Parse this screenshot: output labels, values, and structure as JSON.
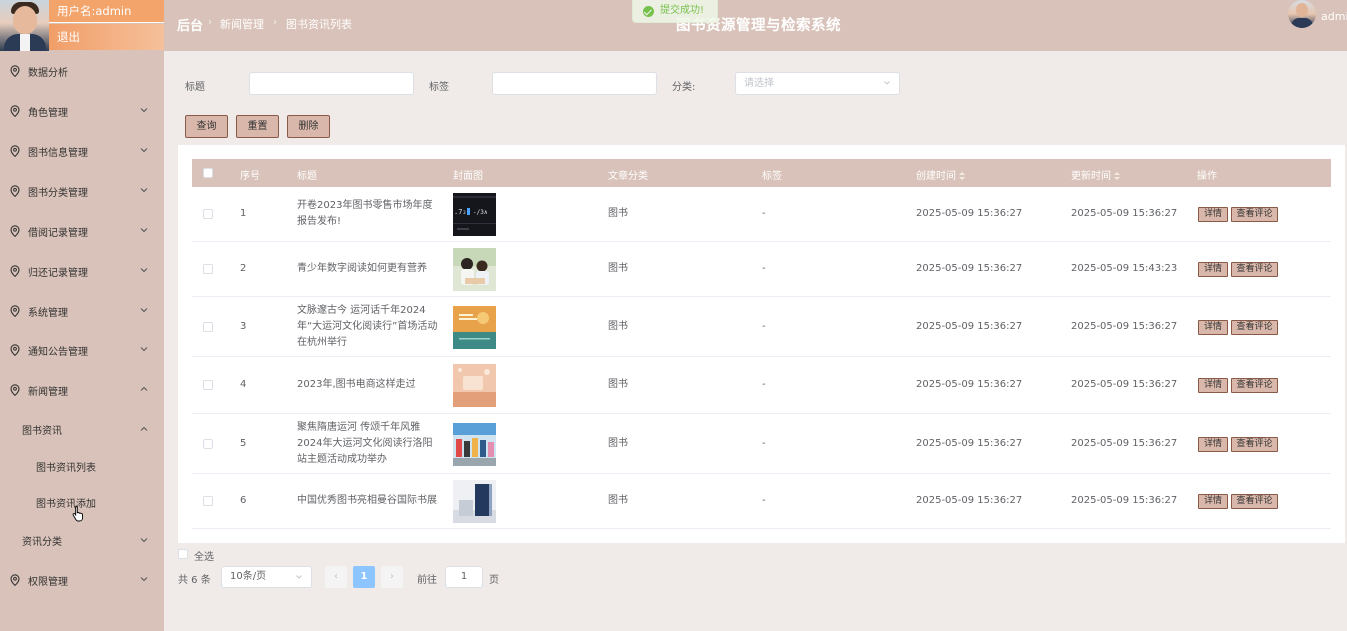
{
  "sidebar": {
    "username": "用户名:admin",
    "logout": "退出",
    "items": [
      {
        "label": "数据分析",
        "expanded": null
      },
      {
        "label": "角色管理",
        "expanded": false
      },
      {
        "label": "图书信息管理",
        "expanded": false
      },
      {
        "label": "图书分类管理",
        "expanded": false
      },
      {
        "label": "借阅记录管理",
        "expanded": false
      },
      {
        "label": "归还记录管理",
        "expanded": false
      },
      {
        "label": "系统管理",
        "expanded": false
      },
      {
        "label": "通知公告管理",
        "expanded": false
      },
      {
        "label": "新闻管理",
        "expanded": true
      }
    ],
    "news_sub": {
      "label": "图书资讯",
      "expanded": true
    },
    "news_children": [
      "图书资讯列表",
      "图书资讯添加"
    ],
    "news_category": "资讯分类",
    "permission": "权限管理"
  },
  "header": {
    "home": "后台",
    "crumb1": "新闻管理",
    "crumb2": "图书资讯列表",
    "title": "图书资源管理与检索系统",
    "user": "admin"
  },
  "toast": {
    "text": "提交成功!",
    "color": "#67c23a"
  },
  "search": {
    "title_label": "标题",
    "tag_label": "标签",
    "category_label": "分类:",
    "category_placeholder": "请选择",
    "query_btn": "查询",
    "reset_btn": "重置",
    "delete_btn": "删除"
  },
  "table": {
    "columns": [
      "序号",
      "标题",
      "封面图",
      "文章分类",
      "标签",
      "创建时间",
      "更新时间",
      "操作"
    ],
    "rows": [
      {
        "no": "1",
        "title": "开卷2023年图书零售市场年度报告发布!",
        "category": "图书",
        "tag": "-",
        "created": "2025-05-09 15:36:27",
        "updated": "2025-05-09 15:36:27"
      },
      {
        "no": "2",
        "title": "青少年数字阅读如何更有营养",
        "category": "图书",
        "tag": "-",
        "created": "2025-05-09 15:36:27",
        "updated": "2025-05-09 15:43:23"
      },
      {
        "no": "3",
        "title": "文脉邃古今 运河话千年2024年“大运河文化阅读行”首场活动在杭州举行",
        "category": "图书",
        "tag": "-",
        "created": "2025-05-09 15:36:27",
        "updated": "2025-05-09 15:36:27"
      },
      {
        "no": "4",
        "title": "2023年,图书电商这样走过",
        "category": "图书",
        "tag": "-",
        "created": "2025-05-09 15:36:27",
        "updated": "2025-05-09 15:36:27"
      },
      {
        "no": "5",
        "title": "聚焦隋唐运河 传颂千年风雅2024年大运河文化阅读行洛阳站主题活动成功举办",
        "category": "图书",
        "tag": "-",
        "created": "2025-05-09 15:36:27",
        "updated": "2025-05-09 15:36:27"
      },
      {
        "no": "6",
        "title": "中国优秀图书亮相曼谷国际书展",
        "category": "图书",
        "tag": "-",
        "created": "2025-05-09 15:36:27",
        "updated": "2025-05-09 15:36:27"
      }
    ],
    "detail_btn": "详情",
    "comment_btn": "查看评论"
  },
  "footer": {
    "select_all": "全选",
    "total": "共 6 条",
    "page_size": "10条/页",
    "current_page": "1",
    "goto_prefix": "前往",
    "goto_value": "1",
    "goto_suffix": "页"
  },
  "colors": {
    "theme": "#d9c2b9",
    "accent": "#f3a46b",
    "button": "#d9b8ab",
    "button_border": "#8a5a48",
    "page_active": "#8cc5ff"
  }
}
